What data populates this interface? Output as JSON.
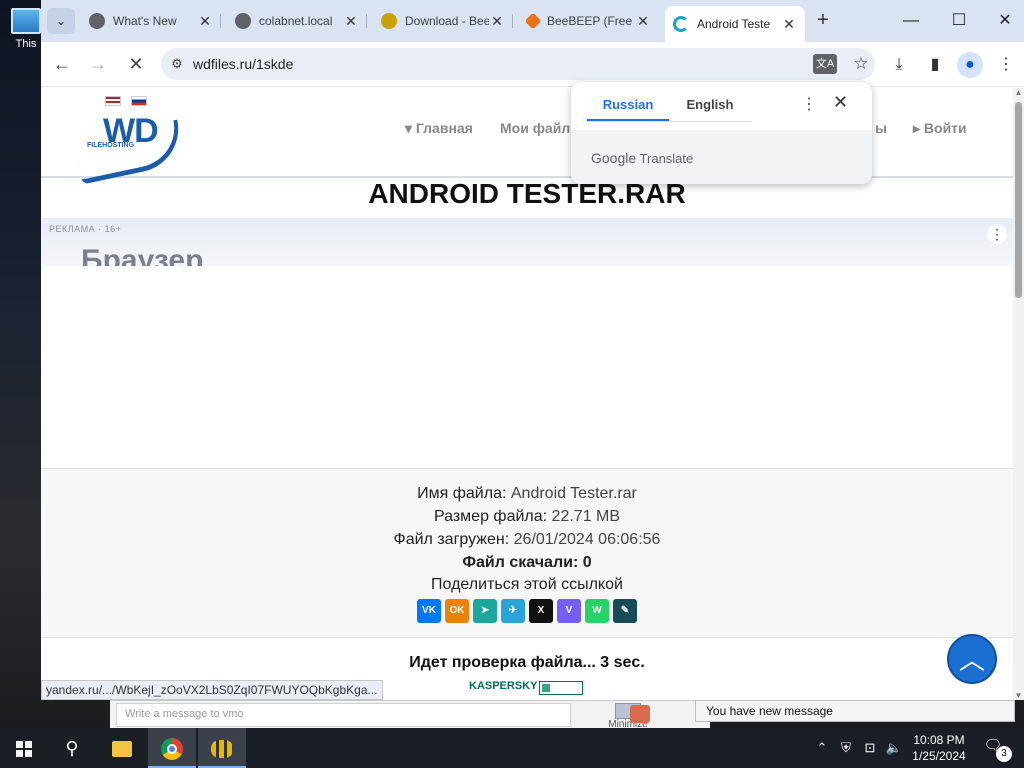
{
  "desktop": {
    "icon_label": "This"
  },
  "browser": {
    "tabs": [
      {
        "title": "What's New",
        "fav_color": "#5f6368"
      },
      {
        "title": "colabnet.local",
        "fav_color": "#5f6368"
      },
      {
        "title": "Download - Bee",
        "fav_color": "#caa200"
      },
      {
        "title": "BeeBEEP (Free",
        "fav_color": "#e8711c"
      },
      {
        "title": "Android Teste",
        "fav_color": "#1aa1c9"
      }
    ],
    "url": "wdfiles.ru/1skde"
  },
  "translate_popup": {
    "lang_from": "Russian",
    "lang_to": "English",
    "brand": "Google",
    "product": "Translate"
  },
  "site": {
    "menu": [
      "▾ Главная",
      "Мои файлы",
      "ы",
      "▸ Войти"
    ],
    "file_title": "ANDROID TESTER.RAR",
    "ad_tag": "РЕКЛАМА · 16+",
    "ad_brand": "Браузер",
    "info": {
      "name_label": "Имя файла:",
      "name_value": "Android Tester.rar",
      "size_label": "Размер файла:",
      "size_value": "22.71 MB",
      "uploaded_label": "Файл загружен:",
      "uploaded_value": "26/01/2024 06:06:56",
      "downloads": "Файл скачали: 0",
      "share_label": "Поделиться этой ссылкой"
    },
    "share_buttons": [
      {
        "name": "vk",
        "label": "VK",
        "color": "#0077ff"
      },
      {
        "name": "ok",
        "label": "OK",
        "color": "#ee8208"
      },
      {
        "name": "moymir",
        "label": "➤",
        "color": "#1ba79c"
      },
      {
        "name": "telegram",
        "label": "✈",
        "color": "#2aa3d9"
      },
      {
        "name": "x",
        "label": "X",
        "color": "#111111"
      },
      {
        "name": "viber",
        "label": "V",
        "color": "#7360f2"
      },
      {
        "name": "whatsapp",
        "label": "W",
        "color": "#25d366"
      },
      {
        "name": "livejournal",
        "label": "✎",
        "color": "#164c57"
      }
    ],
    "check_text": "Идет проверка файла... 3 sec.",
    "kaspersky": "KASPERSKY",
    "kaspersky_progress": 0.2,
    "status_url": "yandex.ru/.../WbKejI_zOoVX2LbS0ZqI07FWUYOQbKgbKga..."
  },
  "chat": {
    "placeholder": "Write a message to vmo",
    "minimize": "Minimize",
    "notification": "You have new message"
  },
  "taskbar": {
    "time": "10:08 PM",
    "date": "1/25/2024",
    "notifications": "3"
  }
}
